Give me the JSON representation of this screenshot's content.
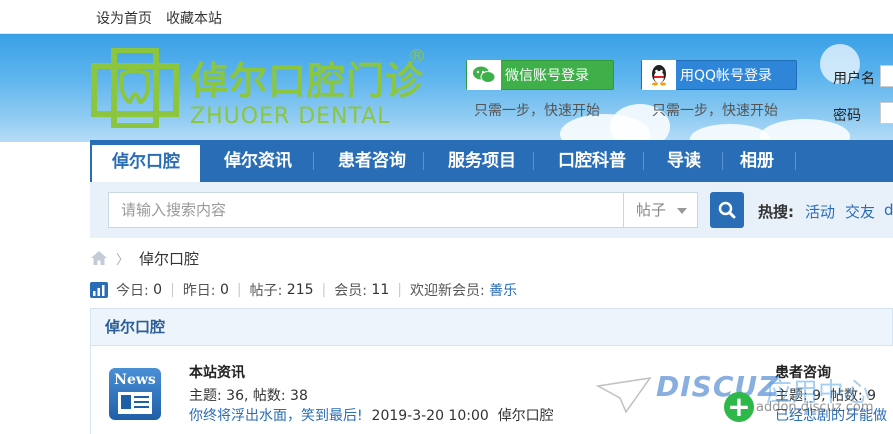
{
  "topbar": {
    "set_home": "设为首页",
    "bookmark": "收藏本站"
  },
  "logo": {
    "name_cn": "倬尔口腔门诊",
    "registered": "®",
    "name_en": "ZHUOER DENTAL",
    "color": "#8cc63f"
  },
  "login": {
    "wechat_label": "微信账号登录",
    "wechat_hint": "只需一步，快速开始",
    "qq_label": "用QQ帐号登录",
    "qq_hint": "只需一步，快速开始",
    "username_label": "用户名",
    "password_label": "密码"
  },
  "nav": {
    "items": [
      {
        "label": "倬尔口腔",
        "active": true
      },
      {
        "label": "倬尔资讯",
        "active": false
      },
      {
        "label": "患者咨询",
        "active": false
      },
      {
        "label": "服务项目",
        "active": false
      },
      {
        "label": "口腔科普",
        "active": false
      },
      {
        "label": "导读",
        "active": false
      },
      {
        "label": "相册",
        "active": false
      }
    ],
    "color": "#2a6db7"
  },
  "search": {
    "placeholder": "请输入搜索内容",
    "type_selected": "帖子",
    "hot_label": "热搜:",
    "hot_links": [
      "活动",
      "交友",
      "d"
    ]
  },
  "breadcrumb": {
    "current": "倬尔口腔"
  },
  "stats": {
    "today_label": "今日:",
    "today": "0",
    "yesterday_label": "昨日:",
    "yesterday": "0",
    "posts_label": "帖子:",
    "posts": "215",
    "members_label": "会员:",
    "members": "11",
    "welcome_label": "欢迎新会员:",
    "new_member": "善乐"
  },
  "forum_group": {
    "title": "倬尔口腔",
    "forums": [
      {
        "icon_text": "News",
        "name": "本站资讯",
        "stats": "主题: 36, 帖数: 38",
        "last_title": "你终将浮出水面，笑到最后!",
        "last_time": "2019-3-20 10:00",
        "last_author": "倬尔口腔"
      },
      {
        "name": "患者咨询",
        "stats": "主题: 9, 帖数: 9",
        "last_title": "已经悲剧的牙能做"
      }
    ]
  },
  "watermark": {
    "brand": "DISCUZ",
    "cn": "应用中心",
    "url": "addon.discuz.com"
  }
}
